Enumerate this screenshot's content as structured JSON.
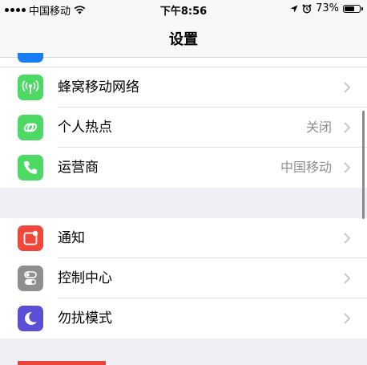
{
  "status_bar": {
    "carrier": "中国移动",
    "time": "下午8:56",
    "battery": "73%",
    "battery_level": 0.73
  },
  "nav": {
    "title": "设置"
  },
  "group1": {
    "rows": [
      {
        "label": "蜂窝移动网络",
        "value": "",
        "icon": "cellular-antenna-icon",
        "color": "#4cd964"
      },
      {
        "label": "个人热点",
        "value": "关闭",
        "icon": "hotspot-chain-icon",
        "color": "#4cd964"
      },
      {
        "label": "运营商",
        "value": "中国移动",
        "icon": "phone-icon",
        "color": "#4cd964"
      }
    ]
  },
  "group2": {
    "rows": [
      {
        "label": "通知",
        "value": "",
        "icon": "notification-icon",
        "color": "#f0473a"
      },
      {
        "label": "控制中心",
        "value": "",
        "icon": "control-center-icon",
        "color": "#8e8e93"
      },
      {
        "label": "勿扰模式",
        "value": "",
        "icon": "moon-icon",
        "color": "#5b4fd6"
      }
    ]
  }
}
